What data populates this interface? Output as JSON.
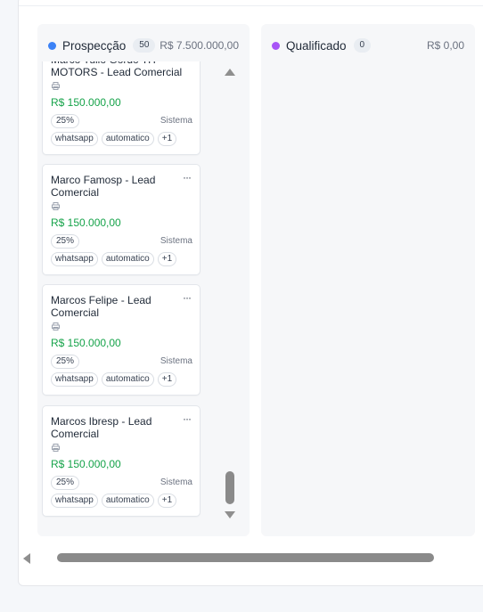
{
  "columns": [
    {
      "title": "Prospecção",
      "count": "50",
      "total": "R$ 7.500.000,00",
      "dot_color": "#3b82f6",
      "cards": [
        {
          "title": "Marco Tulio Gordo TH MOTORS - Lead Comercial",
          "value": "R$ 150.000,00",
          "probability": "25%",
          "source": "Sistema",
          "tags": [
            "whatsapp",
            "automatico",
            "+1"
          ]
        },
        {
          "title": "Marco Famosp - Lead Comercial",
          "value": "R$ 150.000,00",
          "probability": "25%",
          "source": "Sistema",
          "tags": [
            "whatsapp",
            "automatico",
            "+1"
          ]
        },
        {
          "title": "Marcos Felipe - Lead Comercial",
          "value": "R$ 150.000,00",
          "probability": "25%",
          "source": "Sistema",
          "tags": [
            "whatsapp",
            "automatico",
            "+1"
          ]
        },
        {
          "title": "Marcos Ibresp - Lead Comercial",
          "value": "R$ 150.000,00",
          "probability": "25%",
          "source": "Sistema",
          "tags": [
            "whatsapp",
            "automatico",
            "+1"
          ]
        }
      ]
    },
    {
      "title": "Qualificado",
      "count": "0",
      "total": "R$ 0,00",
      "dot_color": "#a855f7",
      "cards": []
    }
  ],
  "card_menu_glyph": "···",
  "card_icon": "printer-icon"
}
